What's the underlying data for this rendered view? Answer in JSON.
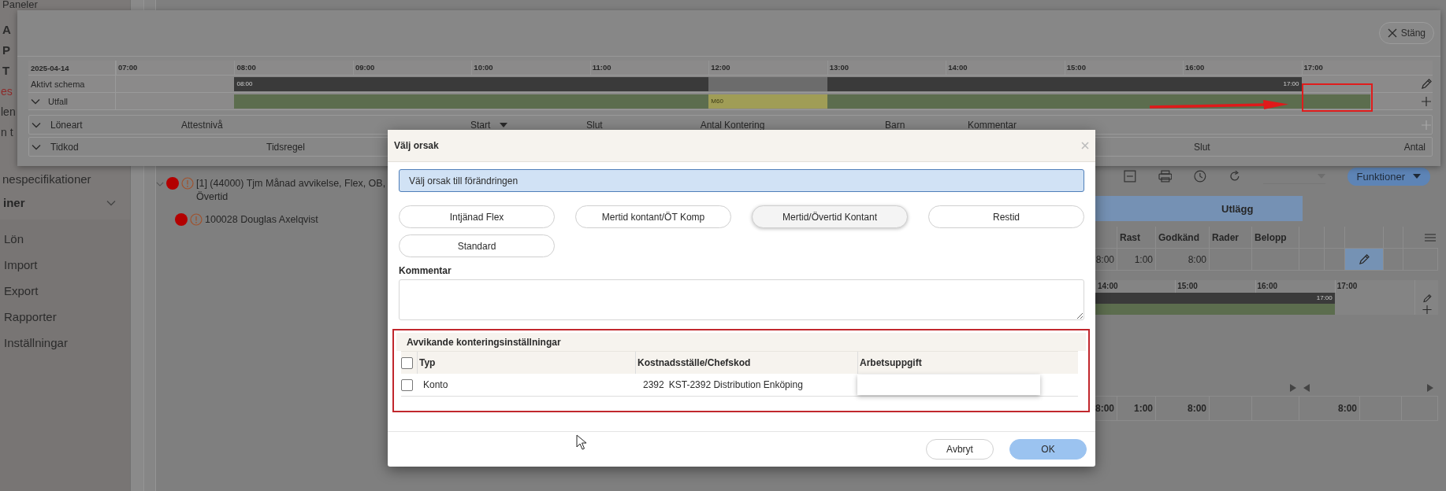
{
  "sidebar": {
    "items": [
      {
        "label": "Paneler",
        "kind": "plain"
      },
      {
        "label": "A",
        "kind": "plain"
      },
      {
        "label": "P",
        "kind": "plain"
      },
      {
        "label": "T",
        "kind": "plain"
      },
      {
        "label": "es",
        "kind": "alert"
      },
      {
        "label": "len",
        "kind": "plain"
      },
      {
        "label": "n t",
        "kind": "plain"
      },
      {
        "label": "nespecifikationer",
        "kind": "spaced"
      },
      {
        "label": "iner",
        "kind": "group"
      },
      {
        "label": "Lön",
        "kind": "nav"
      },
      {
        "label": "Import",
        "kind": "nav"
      },
      {
        "label": "Export",
        "kind": "nav"
      },
      {
        "label": "Rapporter",
        "kind": "nav"
      },
      {
        "label": "Inställningar",
        "kind": "nav"
      }
    ]
  },
  "tree": {
    "items": [
      {
        "label": "[1]  (44000) Tjm Månad avvikelse, Flex, OB, Övertid",
        "expanded": true,
        "children": [
          {
            "label": "100028 Douglas Axelqvist"
          }
        ]
      }
    ]
  },
  "right_panel": {
    "toolbar": {
      "button": "Funktioner"
    },
    "group_header": "Utlägg",
    "columns": [
      "Rast",
      "Godkänd",
      "Rader",
      "Belopp"
    ],
    "row": {
      "cells": [
        "8:00",
        "1:00",
        "8:00"
      ],
      "edit_selected": true
    },
    "timeline": {
      "hours": [
        "14:00",
        "15:00",
        "16:00",
        "17:00"
      ],
      "rows": [
        {
          "kind": "edit",
          "segments": [
            {
              "kind": "schedule",
              "label": "17:00"
            }
          ]
        },
        {
          "kind": "add",
          "segments": [
            {
              "kind": "outcome"
            }
          ]
        }
      ]
    },
    "footer": {
      "cells": [
        "8:00",
        "1:00",
        "8:00"
      ],
      "column_6": "8:00"
    }
  },
  "popup": {
    "close_button": "Stäng",
    "timeline": {
      "date": "2025-04-14",
      "hours": [
        "07:00",
        "08:00",
        "09:00",
        "10:00",
        "11:00",
        "12:00",
        "13:00",
        "14:00",
        "15:00",
        "16:00",
        "17:00"
      ],
      "rows": [
        {
          "label": "Aktivt schema",
          "collapsible": false,
          "kind": "edit",
          "segments": [
            {
              "kind": "schedule",
              "label": "08:00"
            },
            {
              "kind": "break"
            },
            {
              "kind": "schedule",
              "label": "17:00"
            }
          ]
        },
        {
          "label": "Utfall",
          "collapsible": true,
          "kind": "add",
          "segments": [
            {
              "kind": "outcome"
            },
            {
              "kind": "absence",
              "label": "M60"
            },
            {
              "kind": "outcome"
            }
          ]
        }
      ]
    },
    "loneart_row": {
      "label": "Löneart",
      "columns": [
        {
          "label": "Attestnivå",
          "sorted": false
        },
        {
          "label": "Start",
          "sorted": true
        },
        {
          "label": "Slut",
          "sorted": false
        },
        {
          "label": "Antal",
          "sorted": false
        },
        {
          "label": "Kontering",
          "sorted": false
        },
        {
          "label": "Barn",
          "sorted": false
        },
        {
          "label": "Kommentar",
          "sorted": false
        }
      ]
    },
    "tidkod_row": {
      "label": "Tidkod",
      "columns": [
        {
          "label": "Tidsregel"
        },
        {
          "label": "Slut"
        },
        {
          "label": "Antal"
        }
      ]
    }
  },
  "dialog": {
    "title": "Välj orsak",
    "info": "Välj orsak till förändringen",
    "reasons": [
      {
        "label": "Intjänad Flex",
        "selected": false
      },
      {
        "label": "Mertid kontant/ÖT Komp",
        "selected": false
      },
      {
        "label": "Mertid/Övertid Kontant",
        "selected": true
      },
      {
        "label": "Restid",
        "selected": false
      },
      {
        "label": "Standard",
        "selected": false
      }
    ],
    "comment": {
      "label": "Kommentar"
    },
    "accounting": {
      "title": "Avvikande konteringsinställningar",
      "all_checked": false,
      "columns": [
        "Typ",
        "Kostnadsställe/Chefskod",
        "Arbetsuppgift"
      ],
      "rows": [
        {
          "checked": false,
          "type": "Konto",
          "code": "2392",
          "name": "KST-2392 Distribution Enköping"
        }
      ]
    },
    "buttons": [
      {
        "label": "Avbryt",
        "kind": "secondary"
      },
      {
        "label": "OK",
        "kind": "primary"
      }
    ]
  }
}
